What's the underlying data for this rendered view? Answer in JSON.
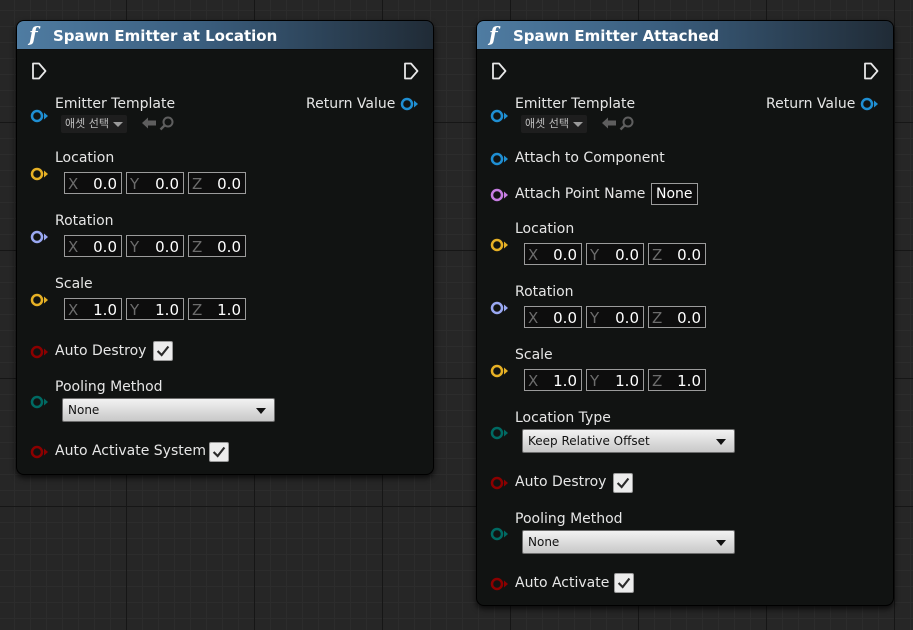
{
  "node_a": {
    "title": "Spawn Emitter at Location",
    "emitter_template": "Emitter Template",
    "asset_picker": "애셋 선택",
    "return_value": "Return Value",
    "location": {
      "label": "Location",
      "x": "0.0",
      "y": "0.0",
      "z": "0.0"
    },
    "rotation": {
      "label": "Rotation",
      "x": "0.0",
      "y": "0.0",
      "z": "0.0"
    },
    "scale": {
      "label": "Scale",
      "x": "1.0",
      "y": "1.0",
      "z": "1.0"
    },
    "auto_destroy": {
      "label": "Auto Destroy",
      "checked": true
    },
    "pooling_method": {
      "label": "Pooling Method",
      "value": "None"
    },
    "auto_activate": {
      "label": "Auto Activate System",
      "checked": true
    }
  },
  "node_b": {
    "title": "Spawn Emitter Attached",
    "emitter_template": "Emitter Template",
    "asset_picker": "애셋 선택",
    "return_value": "Return Value",
    "attach_to_component": "Attach to Component",
    "attach_point_name": {
      "label": "Attach Point Name",
      "value": "None"
    },
    "location": {
      "label": "Location",
      "x": "0.0",
      "y": "0.0",
      "z": "0.0"
    },
    "rotation": {
      "label": "Rotation",
      "x": "0.0",
      "y": "0.0",
      "z": "0.0"
    },
    "scale": {
      "label": "Scale",
      "x": "1.0",
      "y": "1.0",
      "z": "1.0"
    },
    "location_type": {
      "label": "Location Type",
      "value": "Keep Relative Offset"
    },
    "auto_destroy": {
      "label": "Auto Destroy",
      "checked": true
    },
    "pooling_method": {
      "label": "Pooling Method",
      "value": "None"
    },
    "auto_activate": {
      "label": "Auto Activate",
      "checked": true
    }
  },
  "axes": {
    "x": "X",
    "y": "Y",
    "z": "Z"
  },
  "icons": {
    "function": "f"
  },
  "colors": {
    "object_pin": "#1f8fd3",
    "vector_pin": "#e7b125",
    "rotator_pin": "#9aa8f2",
    "bool_pin": "#8c0000",
    "enum_pin": "#006a63",
    "name_pin": "#c77ee3",
    "header": "#4f7ca2"
  }
}
